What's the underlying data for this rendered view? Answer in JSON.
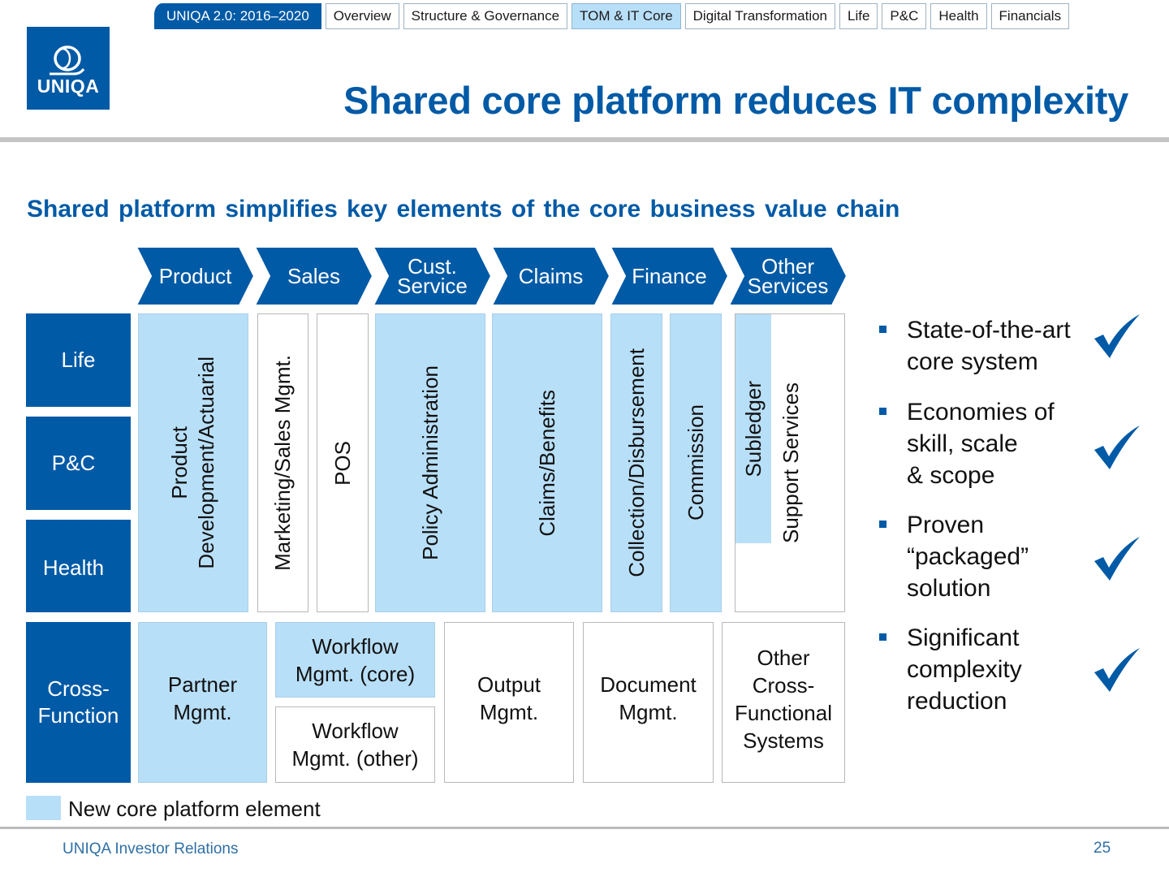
{
  "nav": {
    "tabs": [
      {
        "label": "UNIQA 2.0: 2016–2020",
        "state": "primary"
      },
      {
        "label": "Overview",
        "state": "normal"
      },
      {
        "label": "Structure & Governance",
        "state": "normal"
      },
      {
        "label": "TOM & IT Core",
        "state": "active"
      },
      {
        "label": "Digital Transformation",
        "state": "normal"
      },
      {
        "label": "Life",
        "state": "normal"
      },
      {
        "label": "P&C",
        "state": "normal"
      },
      {
        "label": "Health",
        "state": "normal"
      },
      {
        "label": "Financials",
        "state": "normal"
      }
    ]
  },
  "logo": {
    "text": "UNIQA",
    "icon": "uniqa-q-logo"
  },
  "header": {
    "title": "Shared core platform reduces IT complexity",
    "subtitle": "Shared platform simplifies key elements of the core business value chain"
  },
  "colors": {
    "brand_blue": "#005aa6",
    "new_platform_fill": "#b8dff8",
    "existing_fill": "#ffffff"
  },
  "value_chain": {
    "stages": [
      "Product",
      "Sales",
      "Cust.\nService",
      "Claims",
      "Finance",
      "Other\nServices"
    ]
  },
  "row_labels": {
    "life": "Life",
    "pc": "P&C",
    "health": "Health",
    "cross_function": "Cross-\nFunction"
  },
  "line_elements": [
    {
      "label": "Product\nDevelopment/Actuarial",
      "new_platform": true
    },
    {
      "label": "Marketing/Sales Mgmt.",
      "new_platform": false
    },
    {
      "label": "POS",
      "new_platform": false
    },
    {
      "label": "Policy Administration",
      "new_platform": true
    },
    {
      "label": "Claims/Benefits",
      "new_platform": true
    },
    {
      "label": "Collection/Disbursement",
      "new_platform": true
    },
    {
      "label": "Commission",
      "new_platform": true
    },
    {
      "label": "Subledger",
      "new_platform": true
    },
    {
      "label": "Support Services",
      "new_platform": false
    }
  ],
  "cross_elements": [
    {
      "label": "Partner\nMgmt.",
      "new_platform": true
    },
    {
      "label": "Workflow\nMgmt. (core)",
      "new_platform": true
    },
    {
      "label": "Workflow\nMgmt. (other)",
      "new_platform": false
    },
    {
      "label": "Output\nMgmt.",
      "new_platform": false
    },
    {
      "label": "Document\nMgmt.",
      "new_platform": false
    },
    {
      "label": "Other\nCross-\nFunctional\nSystems",
      "new_platform": false
    }
  ],
  "legend": {
    "label": "New core platform element"
  },
  "benefits": [
    {
      "text": "State-of-the-art\ncore system",
      "checked": true
    },
    {
      "text": "Economies of\nskill, scale\n& scope",
      "checked": true
    },
    {
      "text": "Proven\n“packaged”\nsolution",
      "checked": true
    },
    {
      "text": "Significant\ncomplexity\nreduction",
      "checked": true
    }
  ],
  "footer": {
    "left": "UNIQA Investor Relations",
    "page_number": "25"
  }
}
